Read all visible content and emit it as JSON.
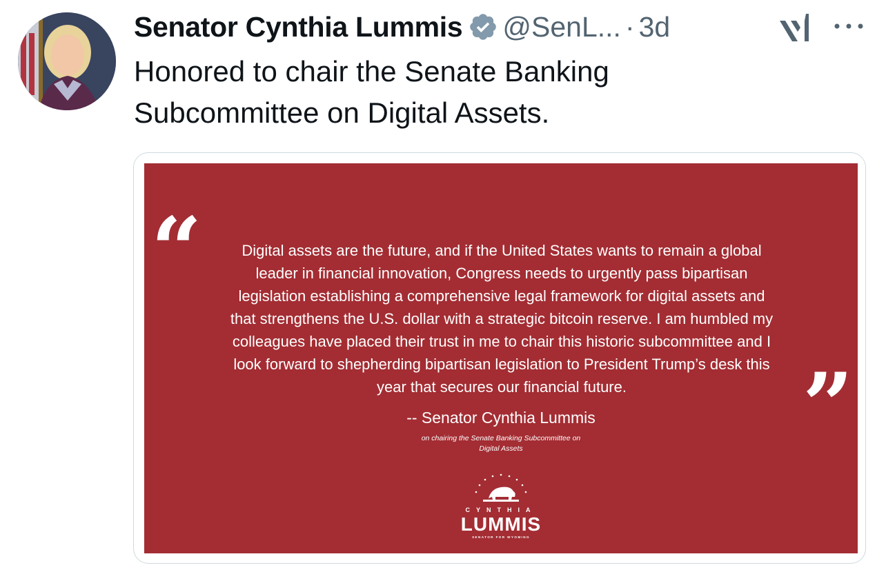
{
  "author": {
    "name": "Senator Cynthia Lummis",
    "handle": "@SenL...",
    "separator": "·",
    "timestamp": "3d",
    "verified_color": "#829aab"
  },
  "tweet": {
    "text_line1": "Honored to chair the Senate Banking",
    "text_line2": "Subcommittee on Digital Assets."
  },
  "media": {
    "background_color": "#a32d33",
    "open_quote_mark": "“",
    "close_quote_mark": "”",
    "quote_lines": [
      "Digital assets are the future, and if the United States wants to remain a global",
      "leader in financial innovation, Congress needs to urgently pass bipartisan",
      "legislation establishing a comprehensive legal framework for digital assets and",
      "that strengthens the U.S. dollar with a strategic bitcoin reserve. I am humbled my",
      "colleagues have placed their trust in me to chair this historic subcommittee and I",
      "look forward to shepherding bipartisan legislation to President Trump’s desk this",
      "year that secures our financial future."
    ],
    "attribution": "-- Senator Cynthia Lummis",
    "subnote_line1": "on chairing the Senate Banking Subcommittee on",
    "subnote_line2": "Digital Assets",
    "logo": {
      "first_name": "CYNTHIA",
      "last_name": "LUMMIS",
      "subtitle": "SENATOR FOR WYOMING"
    }
  },
  "icons": {
    "grok": "grok-icon",
    "more": "more-icon",
    "verified": "verified-badge-icon"
  }
}
